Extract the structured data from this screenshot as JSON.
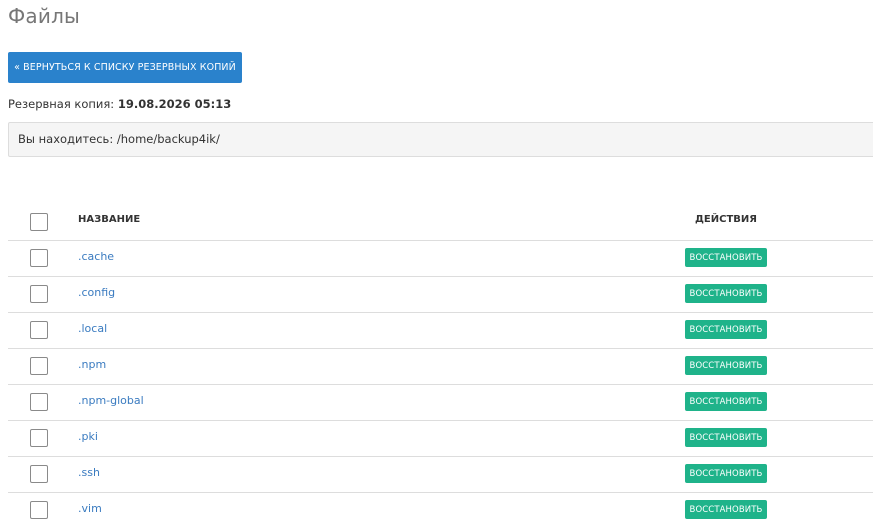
{
  "page": {
    "title": "Файлы"
  },
  "toolbar": {
    "back_label": "« ВЕРНУТЬСЯ К СПИСКУ РЕЗЕРВНЫХ КОПИЙ"
  },
  "backup": {
    "label": "Резервная копия:",
    "date": "19.08.2026 05:13"
  },
  "location": {
    "label": "Вы находитесь:",
    "path": "/home/backup4ik/"
  },
  "table": {
    "columns": {
      "name": "НАЗВАНИЕ",
      "actions": "ДЕЙСТВИЯ"
    },
    "restore_label": "ВОССТАНОВИТЬ",
    "rows": [
      {
        "name": ".cache"
      },
      {
        "name": ".config"
      },
      {
        "name": ".local"
      },
      {
        "name": ".npm"
      },
      {
        "name": ".npm-global"
      },
      {
        "name": ".pki"
      },
      {
        "name": ".ssh"
      },
      {
        "name": ".vim"
      }
    ]
  },
  "colors": {
    "primary_button": "#2a82cc",
    "restore_button": "#1fb38a",
    "link": "#3a7bc0"
  }
}
